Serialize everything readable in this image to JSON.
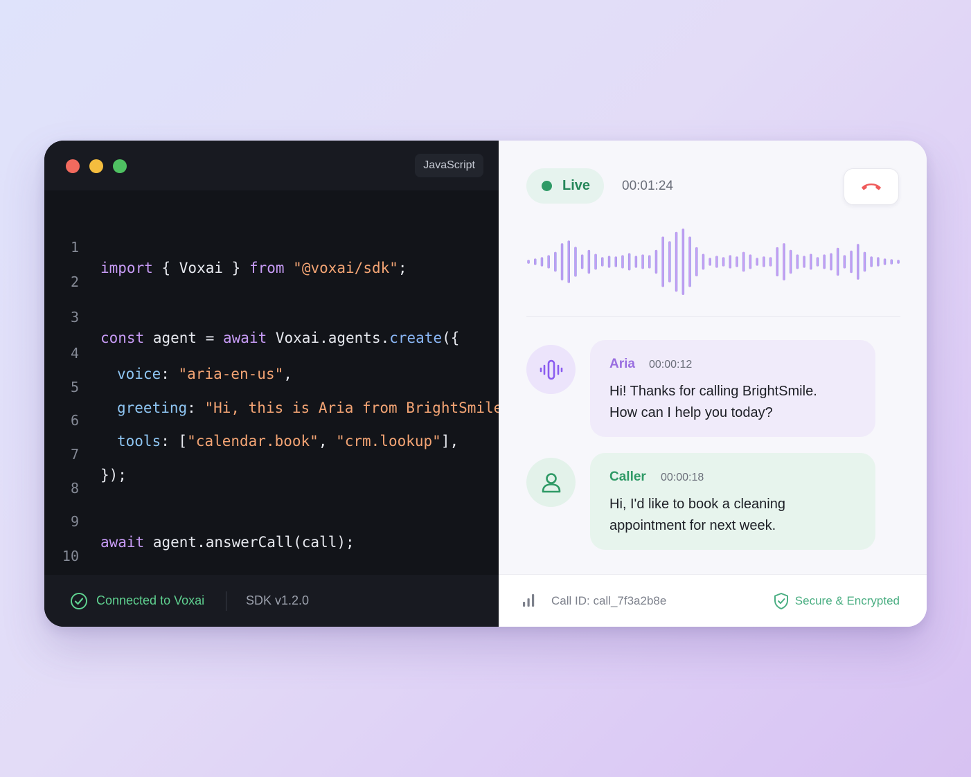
{
  "editor": {
    "language_badge": "JavaScript",
    "line_numbers": [
      "1",
      "2",
      "3",
      "4",
      "5",
      "6",
      "7",
      "8",
      "9",
      "10"
    ],
    "code": {
      "l1": {
        "kw1": "import",
        "t1": " { Voxai } ",
        "kw2": "from",
        "t2": " ",
        "str1": "\"@voxai/sdk\"",
        "t3": ";"
      },
      "l3": {
        "kw1": "const",
        "t1": " agent = ",
        "kw2": "await",
        "t2": " Voxai.agents.",
        "fn1": "create",
        "t3": "({"
      },
      "l4": {
        "prop": "voice",
        "t1": ": ",
        "str1": "\"aria-en-us\"",
        "t2": ","
      },
      "l5": {
        "prop": "greeting",
        "t1": ": ",
        "str1": "\"Hi, this is Aria from BrightSmile…\"",
        "t2": ","
      },
      "l6": {
        "prop": "tools",
        "t1": ": [",
        "str1": "\"calendar.book\"",
        "t2": ", ",
        "str2": "\"crm.lookup\"",
        "t3": "],"
      },
      "l7": {
        "t1": "});"
      },
      "l9": {
        "kw1": "await",
        "t1": " agent.answerCall(call);"
      }
    },
    "status": {
      "connection": "Connected to Voxai",
      "sdk_version": "SDK v1.2.0"
    }
  },
  "call": {
    "live_label": "Live",
    "duration": "00:01:24",
    "hangup_icon": "phone-hangup-icon",
    "waveform_amplitudes": [
      0.06,
      0.1,
      0.14,
      0.2,
      0.3,
      0.56,
      0.64,
      0.45,
      0.22,
      0.36,
      0.24,
      0.14,
      0.18,
      0.16,
      0.2,
      0.26,
      0.18,
      0.22,
      0.2,
      0.36,
      0.76,
      0.62,
      0.9,
      1.0,
      0.76,
      0.44,
      0.24,
      0.12,
      0.18,
      0.14,
      0.2,
      0.16,
      0.3,
      0.22,
      0.12,
      0.16,
      0.14,
      0.44,
      0.56,
      0.36,
      0.22,
      0.18,
      0.24,
      0.14,
      0.22,
      0.26,
      0.42,
      0.2,
      0.34,
      0.54,
      0.3,
      0.16,
      0.14,
      0.1,
      0.08,
      0.06
    ],
    "colors": {
      "waveform_start": "#8f9bef",
      "waveform_mid": "#d99ef0",
      "waveform_end": "#8f9bef",
      "live_green": "#2f9a66",
      "hangup_red": "#ef5a5a"
    },
    "transcript": [
      {
        "speaker": "Aria",
        "time": "00:00:12",
        "line1": "Hi! Thanks for calling BrightSmile.",
        "line2": "How can I help you today?",
        "avatar_icon": "voice-wave-icon"
      },
      {
        "speaker": "Caller",
        "time": "00:00:18",
        "line1": "Hi, I'd like to book a cleaning",
        "line2": "appointment for next week.",
        "avatar_icon": "user-icon"
      }
    ],
    "footer": {
      "call_id": "Call ID: call_7f3a2b8e",
      "security": "Secure & Encrypted"
    }
  }
}
